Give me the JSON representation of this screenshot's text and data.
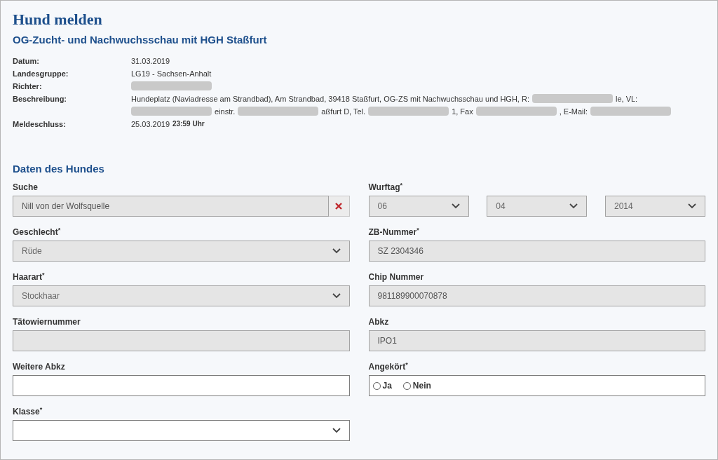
{
  "title": "Hund melden",
  "event_title": "OG-Zucht- und Nachwuchsschau mit HGH Staßfurt",
  "info": [
    {
      "label": "Datum:",
      "segments": [
        {
          "kind": "text",
          "text": "31.03.2019"
        }
      ]
    },
    {
      "label": "Landesgruppe:",
      "segments": [
        {
          "kind": "text",
          "text": "LG19 - Sachsen-Anhalt"
        }
      ]
    },
    {
      "label": "Richter:",
      "segments": [
        {
          "kind": "redacted"
        }
      ]
    },
    {
      "label": "Beschreibung:",
      "segments": [
        {
          "kind": "text",
          "text": "Hundeplatz (Naviadresse am Strandbad), Am Strandbad, 39418 Staßfurt, OG-ZS mit Nachwuchsschau und HGH, R:"
        },
        {
          "kind": "redacted"
        },
        {
          "kind": "text",
          "text": "le, VL:"
        },
        {
          "kind": "redacted"
        },
        {
          "kind": "text",
          "text": "einstr."
        },
        {
          "kind": "redacted"
        },
        {
          "kind": "text",
          "text": "aßfurt D, Tel."
        },
        {
          "kind": "redacted"
        },
        {
          "kind": "text",
          "text": "1, Fax"
        },
        {
          "kind": "redacted"
        },
        {
          "kind": "text",
          "text": ", E-Mail:"
        },
        {
          "kind": "redacted"
        }
      ]
    },
    {
      "label": "Meldeschluss:",
      "segments": [
        {
          "kind": "text",
          "text": "25.03.2019"
        },
        {
          "kind": "time",
          "text": "23:59 Uhr"
        }
      ]
    }
  ],
  "section_title": "Daten des Hundes",
  "left_fields": [
    {
      "kind": "search",
      "label": "Suche",
      "value": "Nill von der Wolfsquelle",
      "disabled": true
    },
    {
      "kind": "select",
      "label": "Geschlecht$^{*}$",
      "value": "Rüde",
      "disabled": true
    },
    {
      "kind": "select",
      "label": "Haarart$^{*}$",
      "value": "Stockhaar",
      "disabled": true
    },
    {
      "kind": "text",
      "label": "Tätowiernummer",
      "disabled": true
    },
    {
      "kind": "text",
      "label": "Weitere Abkz",
      "disabled": false
    },
    {
      "kind": "select",
      "label": "Klasse$^{*}$",
      "disabled": false
    }
  ],
  "right_fields": [
    {
      "kind": "date",
      "label": "Wurftag$^{*}$",
      "parts": [
        "06",
        "04",
        "2014"
      ],
      "disabled": true
    },
    {
      "kind": "text",
      "label": "ZB-Nummer$^{*}$",
      "value": "SZ 2304346",
      "disabled": true
    },
    {
      "kind": "text",
      "label": "Chip Nummer",
      "value": "981189900070878",
      "disabled": true
    },
    {
      "kind": "text",
      "label": "Abkz",
      "value": "IPO1",
      "disabled": true
    },
    {
      "kind": "radio",
      "label": "Angekört$^{*}$",
      "options": [
        {
          "label": "Ja",
          "selected": false
        },
        {
          "label": "Nein",
          "selected": false
        }
      ],
      "disabled": false
    }
  ]
}
